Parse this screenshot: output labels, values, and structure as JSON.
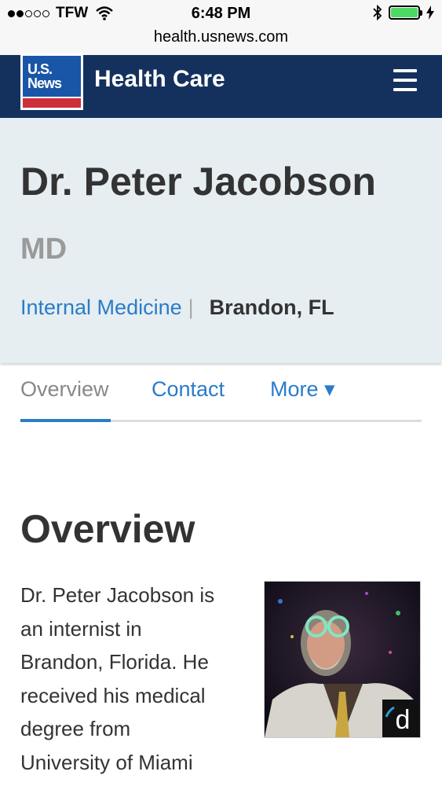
{
  "status_bar": {
    "carrier": "TFW",
    "time": "6:48 PM",
    "url": "health.usnews.com"
  },
  "navbar": {
    "logo_text_line1": "U.S.",
    "logo_text_line2": "News",
    "title": "Health Care"
  },
  "doctor": {
    "name": "Dr. Peter Jacobson",
    "credentials": "MD",
    "specialty": "Internal Medicine",
    "separator": "|",
    "location": "Brandon, FL"
  },
  "tabs": {
    "overview": "Overview",
    "contact": "Contact",
    "more": "More ▾"
  },
  "overview": {
    "title": "Overview",
    "text_lines": [
      "Dr. Peter Jacobson is",
      "an internist in",
      "Brandon, Florida. He",
      "received his medical",
      "degree from",
      "University of Miami"
    ],
    "photo_badge": "d"
  }
}
